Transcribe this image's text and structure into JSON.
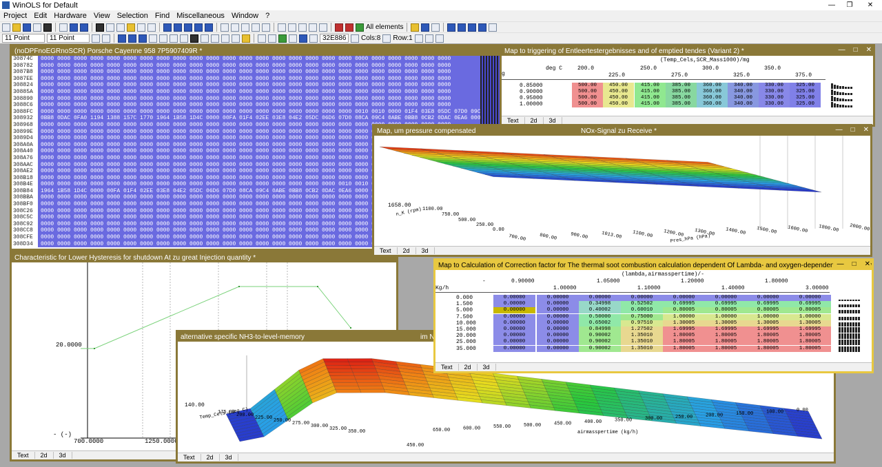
{
  "app": {
    "title": "WinOLS for Default"
  },
  "menu": [
    "Project",
    "Edit",
    "Hardware",
    "View",
    "Selection",
    "Find",
    "Miscellaneous",
    "Window",
    "?"
  ],
  "toolbar": {
    "filter_label": "All elements",
    "font1": "11 Point",
    "font2": "11 Point",
    "address": "32E886",
    "cols": "Cols:8",
    "row": "Row:1"
  },
  "hex_window": {
    "title": "(noDPFnoEGRnoSCR) Porsche Cayenne 958  7P5907409R  *",
    "addresses": [
      "30874C",
      "308782",
      "3087B8",
      "3087EE",
      "308824",
      "30885A",
      "308890",
      "3088C6",
      "3088FC",
      "308932",
      "308968",
      "30899E",
      "3089D4",
      "308A0A",
      "308A40",
      "308A76",
      "308AAC",
      "308AE2",
      "308B18",
      "308B4E",
      "308B84",
      "308BBA",
      "308BF0",
      "308C26",
      "308C5C",
      "308C92",
      "308CC8",
      "308CFE",
      "308D34"
    ],
    "rows": {
      "zero": "0000 0000 0000 0000 0000 0000 0000 0000 0000 0000 0000 0000 0000 0000 0000 0000 0000 0000 0000 0000 0000 0000 0000 0000 0000",
      "r8": "0000 0000 0000 0000 0000 0000 0000 0000 0000 0000 0000 0000 0000 0000 0000 0000 0000 0000 0000 0010 0010 0000 01F4 03E8 05DC 07D0 09C4",
      "r9": "0BB8 0DAC 0FA0 1194 1388 157C 1770 1964 1B58 1D4C 0000 00FA 01F4 02EE 03E8 04E2 05DC 06D6 07D0 08CA 09C4 0ABE 0BB8 0CB2 0DAC 0EA6 0000",
      "r19": "0000 0000 0000 0000 0000 0000 0000 0000 0000 0000 0000 0000 0000 0000 0000 0000 0000 0000 0010 0010 0000 01F4 03E8 05DC 07D0 09C4 0BB8",
      "r20": "1964 1B58 1D4C 0000 00FA 01F4 02EE 03E8 04E2 05DC 06D6 07D0 08CA 09C4 0ABE 0BB8 0CB2 0DAC 0EA6 0000 0000 0000 0000 0000 0000 0000"
    }
  },
  "trigger_window": {
    "title": "Map to triggering of Entleertestergebnisses and of emptied tendes (Variant 2) *",
    "axis_label": "(Temp_Cels,SCR_Mass1000)/mg",
    "unit_row": "deg C",
    "col_headers_top": [
      "200.0",
      "250.0",
      "300.0",
      "350.0"
    ],
    "col_headers_bottom": [
      "225.0",
      "275.0",
      "325.0",
      "375.0"
    ],
    "row_labels": [
      "0.85000",
      "0.90000",
      "0.95000",
      "1.00000"
    ],
    "row_values": [
      "500.00",
      "450.00",
      "415.00",
      "385.00",
      "360.00",
      "340.00",
      "330.00",
      "325.00"
    ],
    "cell_colors": [
      "#f09090",
      "#e8e890",
      "#90e890",
      "#88d8a0",
      "#88c8d8",
      "#8898e0",
      "#8888e8",
      "#8080e8"
    ],
    "tabs": [
      "Text",
      "2d",
      "3d"
    ]
  },
  "nox_window": {
    "title_left": "Map, um pressure compensated",
    "title_center": "NOx-Signal zu Receive *",
    "z_label": "1658.00",
    "y_axis": "n_K (rpm)",
    "y_ticks": [
      "1100.00",
      "750.00",
      "500.00",
      "250.00",
      "0.00"
    ],
    "x_axis": "Pres_hPa (hPa)",
    "x_ticks": [
      "700.00",
      "800.00",
      "900.00",
      "1013.00",
      "1100.00",
      "1200.00",
      "1300.00",
      "1400.00",
      "1500.00",
      "1600.00",
      "1800.00",
      "2000.00"
    ],
    "tabs": [
      "Text",
      "2d",
      "3d"
    ]
  },
  "hysteresis_window": {
    "title": "Characteristic for Lower Hysteresis for shutdown At zu great Injection quantity *",
    "y_label": "20.0000",
    "y_min": "- (-)",
    "x_labels": [
      "700.0000",
      "1250.0000"
    ],
    "curve": [
      [
        0,
        20
      ],
      [
        350,
        35
      ],
      [
        540,
        35
      ],
      [
        620,
        25
      ]
    ],
    "tabs": [
      "Text",
      "2d",
      "3d"
    ]
  },
  "nh3_window": {
    "title": "alternative specific NH3-to-level-memory",
    "title_right": "im N",
    "z_label": "140.00",
    "y_axis": "Temp_Cels (deg C)",
    "y_ticks": [
      "175.00",
      "200.00",
      "225.00",
      "250.00",
      "275.00",
      "300.00",
      "325.00",
      "350.00",
      "450.00"
    ],
    "x_axis": "airmasspertime (kg/h)",
    "x_ticks": [
      "650.00",
      "600.00",
      "550.00",
      "500.00",
      "450.00",
      "400.00",
      "350.00",
      "300.00",
      "250.00",
      "200.00",
      "150.00",
      "100.00",
      "0.00"
    ],
    "tabs": [
      "Text",
      "2d",
      "3d"
    ]
  },
  "correction_window": {
    "title": "Map to Calculation of Correction factor for The thermal soot combustion calculation dependent Of Lambda- and oxygen-dependent mass flow *",
    "axis_label": "(lambda,airmasspertime)/-",
    "row_axis_label": "Kg/h",
    "dash": "-",
    "col_headers_top": [
      "0.90000",
      "1.05000",
      "1.20000",
      "1.80000"
    ],
    "col_headers_bottom": [
      "1.00000",
      "1.10000",
      "1.40000",
      "3.00000"
    ],
    "row_labels": [
      "0.000",
      "1.500",
      "5.000",
      "7.500",
      "10.000",
      "15.000",
      "20.000",
      "25.000",
      "35.000"
    ],
    "rows": [
      [
        "0.00000",
        "0.00000",
        "0.00000",
        "0.00000",
        "0.00000",
        "0.00000",
        "0.00000",
        "0.00000"
      ],
      [
        "0.00000",
        "0.00000",
        "0.34998",
        "0.52502",
        "0.69995",
        "0.69995",
        "0.69995",
        "0.69995"
      ],
      [
        "0.00000",
        "0.00000",
        "0.40002",
        "0.60010",
        "0.80005",
        "0.80005",
        "0.80005",
        "0.80005"
      ],
      [
        "0.00000",
        "0.00000",
        "0.50000",
        "0.75000",
        "1.00000",
        "1.00000",
        "1.00000",
        "1.00000"
      ],
      [
        "0.00000",
        "0.00000",
        "0.65002",
        "0.97510",
        "1.30005",
        "1.30005",
        "1.30005",
        "1.30005"
      ],
      [
        "0.00000",
        "0.00000",
        "0.84998",
        "1.27502",
        "1.69995",
        "1.69995",
        "1.69995",
        "1.69995"
      ],
      [
        "0.00000",
        "0.00000",
        "0.90002",
        "1.35010",
        "1.80005",
        "1.80005",
        "1.80005",
        "1.80005"
      ],
      [
        "0.00000",
        "0.00000",
        "0.90002",
        "1.35010",
        "1.80005",
        "1.80005",
        "1.80005",
        "1.80005"
      ],
      [
        "0.00000",
        "0.00000",
        "0.90002",
        "1.35010",
        "1.80005",
        "1.80005",
        "1.80005",
        "1.80005"
      ]
    ],
    "tabs": [
      "Text",
      "2d",
      "3d"
    ]
  }
}
